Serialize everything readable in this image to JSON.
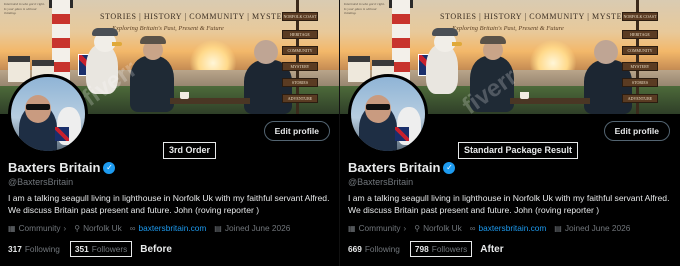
{
  "left": {
    "banner": {
      "menu": "STORIES | HISTORY | COMMUNITY | MYSTERY",
      "tagline": "Exploring Britain's Past, Present & Future",
      "motto": "Interested in who got it right. Is your glass is without thinking.",
      "signs": [
        "NORFOLK COAST",
        "HERITAGE",
        "COMMUNITY",
        "MYSTERY",
        "STORIES",
        "ADVENTURE"
      ]
    },
    "edit_label": "Edit profile",
    "callout": "3rd Order",
    "name": "Baxters Britain",
    "handle": "@BaxtersBritain",
    "bio": "I am a talking seagull living in lighthouse in Norfolk Uk with my faithful servant Alfred. We discuss Britain past present and future. John (roving reporter )",
    "community": "Community",
    "location": "Norfolk Uk",
    "website": "baxtersbritain.com",
    "joined": "Joined June 2026",
    "following_count": "317",
    "following_label": "Following",
    "followers_count": "351",
    "followers_label": "Followers",
    "result_label": "Before",
    "watermark": "fiverr"
  },
  "right": {
    "banner": {
      "menu": "STORIES | HISTORY | COMMUNITY | MYSTERY",
      "tagline": "Exploring Britain's Past, Present & Future",
      "motto": "Interested in who got it right. Is your glass is without thinking.",
      "signs": [
        "NORFOLK COAST",
        "HERITAGE",
        "COMMUNITY",
        "MYSTERY",
        "STORIES",
        "ADVENTURE"
      ]
    },
    "edit_label": "Edit profile",
    "callout": "Standard Package Result",
    "name": "Baxters Britain",
    "handle": "@BaxtersBritain",
    "bio": "I am a talking seagull living in lighthouse in Norfolk Uk with my faithful servant Alfred. We discuss Britain past present and future. John (roving reporter )",
    "community": "Community",
    "location": "Norfolk Uk",
    "website": "baxtersbritain.com",
    "joined": "Joined June 2026",
    "following_count": "669",
    "following_label": "Following",
    "followers_count": "798",
    "followers_label": "Followers",
    "result_label": "After",
    "watermark": "fiverr"
  },
  "colors": {
    "accent": "#1d9bf0",
    "text": "#e7e9ea",
    "muted": "#71767b",
    "background": "#000000"
  },
  "icons": [
    "verified-badge-icon",
    "community-icon",
    "location-icon",
    "link-icon",
    "calendar-icon",
    "chevron-right-icon"
  ]
}
